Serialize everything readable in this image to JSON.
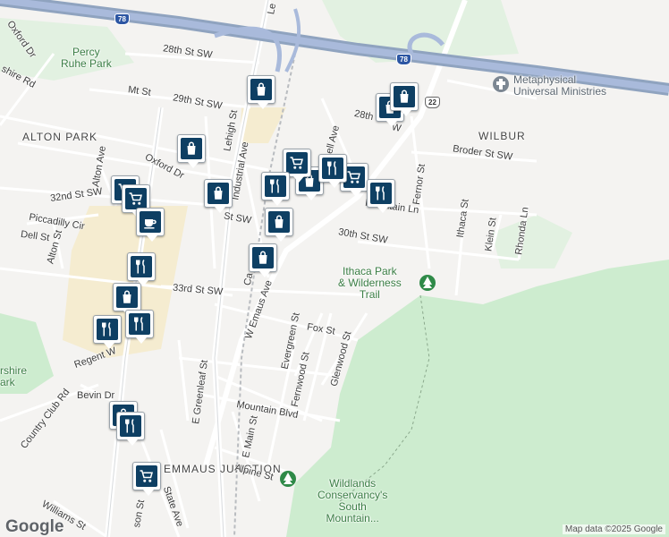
{
  "map": {
    "area_labels": {
      "alton_park": "ALTON PARK",
      "wilbur": "WILBUR",
      "emmaus_junction": "EMMAUS JUNCTION"
    },
    "park_labels": {
      "percy_ruhe": "Percy\nRuhe Park",
      "ithaca": "Ithaca Park\n& Wilderness\nTrail",
      "wildlands": "Wildlands\nConservancy's\nSouth\nMountain...",
      "bershire": "rshire\nark"
    },
    "poi_labels": {
      "ministries": "Metaphysical\nUniversal Ministries"
    },
    "streets": {
      "28th_st_sw_west": "28th St SW",
      "mt_st": "Mt St",
      "29th_st_sw": "29th St SW",
      "oxford_dr_nw": "Oxford Dr",
      "oxford_dr": "Oxford Dr",
      "shire_rd": "shire Rd",
      "32nd_st_sw": "32nd St SW",
      "piccadilly": "Piccadilly Cir",
      "dell_st": "Dell St",
      "alton_st": "Alton St",
      "alton_ave": "Alton Ave",
      "33rd_st_sw": "33rd St SW",
      "lehigh_st": "Lehigh St",
      "lehigh_st_top": "Le",
      "industrial_ave": "Industrial Ave",
      "st_sw_frag": "St SW",
      "ca_frag": "Ca",
      "w_emaus_ave": "W Emaus Ave",
      "28th_st_sw_east": "28th",
      "sw_frag": "W",
      "hill_frag": "ell Ave",
      "broder_st_sw": "Broder St SW",
      "fernor_st": "Fernor St",
      "mountain_ln": "Mountain Ln",
      "ithaca_st": "Ithaca St",
      "klein_st": "Klein St",
      "rhonda_ln": "Rhonda Ln",
      "30th_st_sw": "30th St SW",
      "evergreen_st": "Evergreen St",
      "fox_st": "Fox St",
      "fernwood_st": "Fernwood St",
      "glenwood_st": "Glenwood St",
      "e_greenleaf_st": "E Greenleaf St",
      "regent_frag": "Regent W",
      "bevin_dr": "Bevin Dr",
      "country_club_rd": "Country Club Rd",
      "mountain_blvd": "Mountain Blvd",
      "e_main_st": "E Main St",
      "alpine_st": "Alpine St",
      "williams_st": "Williams St",
      "ison_frag": "son St",
      "state_ave": "State Ave"
    },
    "shields": [
      "78",
      "78",
      "22"
    ],
    "pins": [
      {
        "type": "shopping-bag"
      },
      {
        "type": "shopping-bag"
      },
      {
        "type": "shopping-bag"
      },
      {
        "type": "shopping-bag"
      },
      {
        "type": "shopping-bag"
      },
      {
        "type": "shopping-bag"
      },
      {
        "type": "shopping-bag"
      },
      {
        "type": "shopping-bag"
      },
      {
        "type": "shopping-bag"
      },
      {
        "type": "shopping-bag"
      },
      {
        "type": "shopping-cart"
      },
      {
        "type": "shopping-cart"
      },
      {
        "type": "shopping-cart"
      },
      {
        "type": "shopping-cart"
      },
      {
        "type": "shopping-cart"
      },
      {
        "type": "restaurant"
      },
      {
        "type": "restaurant"
      },
      {
        "type": "restaurant"
      },
      {
        "type": "restaurant"
      },
      {
        "type": "restaurant"
      },
      {
        "type": "restaurant"
      },
      {
        "type": "restaurant"
      },
      {
        "type": "cafe"
      }
    ],
    "colors": {
      "pin_fill": "#0e3f63",
      "park_green": "#cdeccf",
      "highway": "#8fa3bf",
      "commercial": "#f5ecd0"
    }
  },
  "branding": {
    "logo": "Google",
    "attribution": "Map data ©2025 Google"
  }
}
